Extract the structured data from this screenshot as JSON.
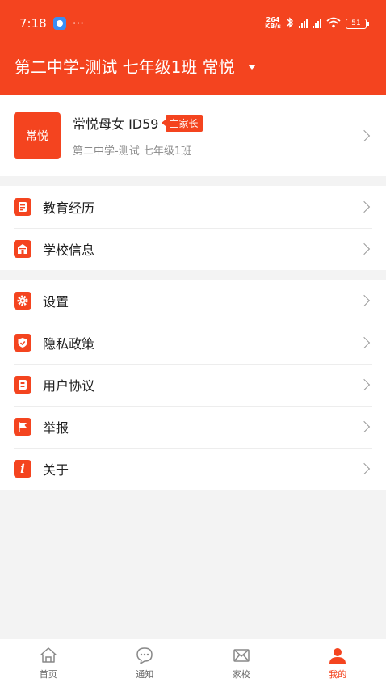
{
  "status": {
    "time": "7:18",
    "more": "···",
    "speed_value": "264",
    "speed_unit": "KB/s",
    "battery": "51"
  },
  "header": {
    "class_title": "第二中学-测试 七年级1班 常悦"
  },
  "profile": {
    "avatar_text": "常悦",
    "name": "常悦母女 ID59",
    "role_badge": "主家长",
    "subtitle": "第二中学-测试  七年级1班"
  },
  "groups": [
    {
      "items": [
        {
          "label": "教育经历",
          "icon": "document-icon"
        },
        {
          "label": "学校信息",
          "icon": "school-icon"
        }
      ]
    },
    {
      "items": [
        {
          "label": "设置",
          "icon": "gear-icon"
        },
        {
          "label": "隐私政策",
          "icon": "shield-icon"
        },
        {
          "label": "用户协议",
          "icon": "agreement-icon"
        },
        {
          "label": "举报",
          "icon": "flag-icon"
        },
        {
          "label": "关于",
          "icon": "info-icon"
        }
      ]
    }
  ],
  "tabs": [
    {
      "label": "首页",
      "icon": "home-icon",
      "active": false
    },
    {
      "label": "通知",
      "icon": "chat-icon",
      "active": false
    },
    {
      "label": "家校",
      "icon": "envelope-icon",
      "active": false
    },
    {
      "label": "我的",
      "icon": "user-icon",
      "active": true
    }
  ],
  "colors": {
    "accent": "#f4441f",
    "background": "#f3f3f3"
  }
}
